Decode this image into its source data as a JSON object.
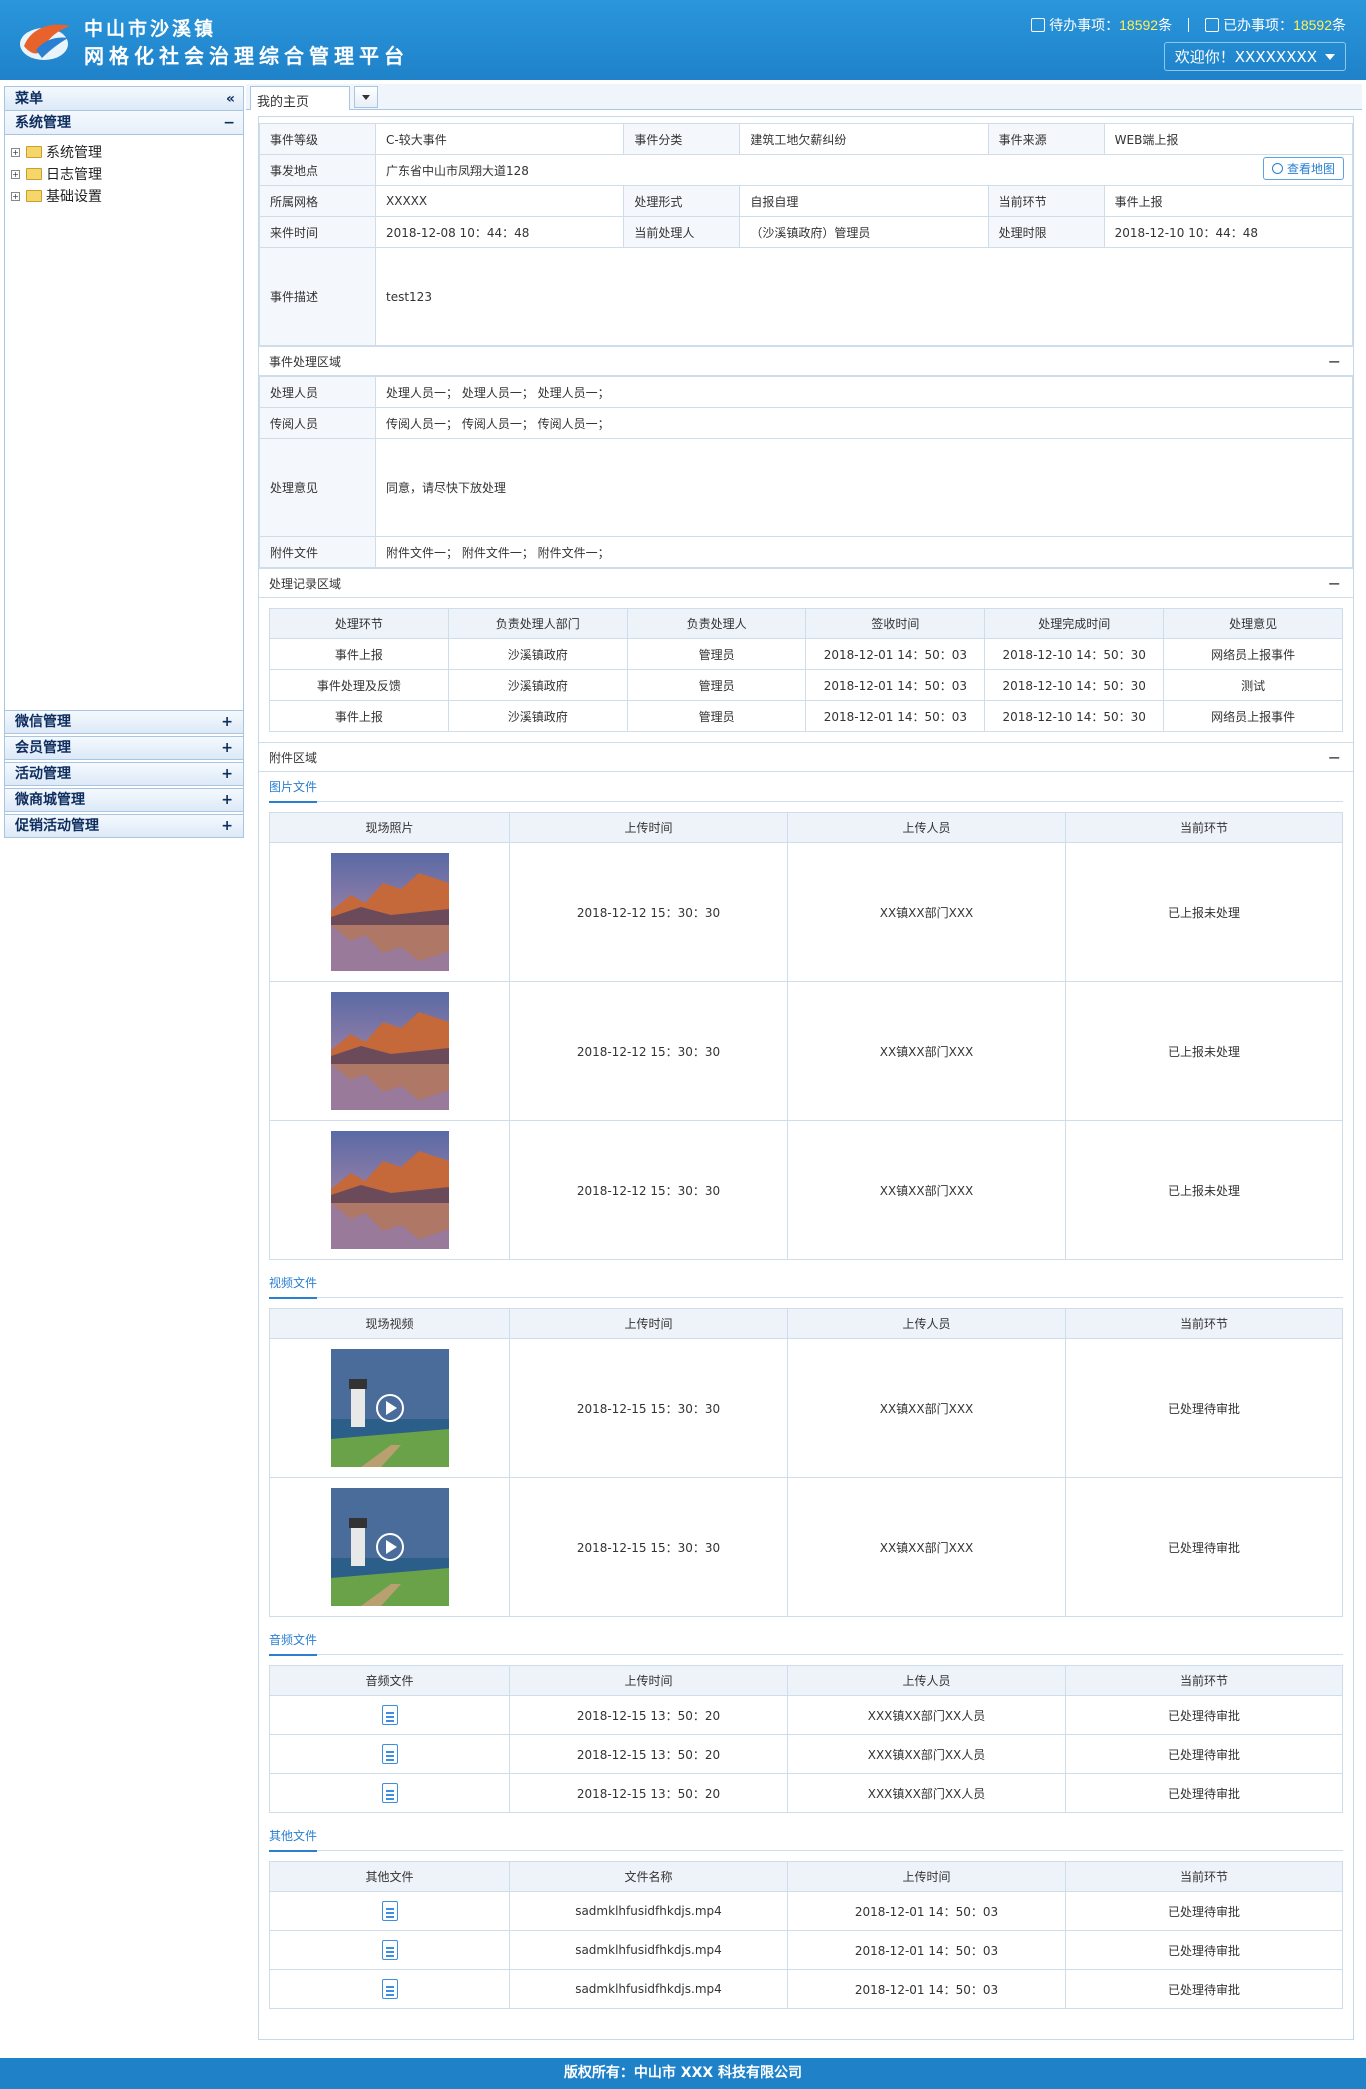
{
  "header": {
    "title_line1": "中山市沙溪镇",
    "title_line2": "网格化社会治理综合管理平台",
    "todo_label": "待办事项：",
    "todo_count": "18592",
    "todo_unit": "条",
    "done_label": "已办事项：",
    "done_count": "18592",
    "done_unit": "条",
    "welcome": "欢迎你！XXXXXXXX"
  },
  "sidebar": {
    "menu_title": "菜单",
    "collapse_glyph": "«",
    "group_title": "系统管理",
    "group_toggle": "−",
    "tree": [
      {
        "label": "系统管理"
      },
      {
        "label": "日志管理"
      },
      {
        "label": "基础设置"
      }
    ],
    "accordions": [
      {
        "label": "微信管理",
        "glyph": "+"
      },
      {
        "label": "会员管理",
        "glyph": "+"
      },
      {
        "label": "活动管理",
        "glyph": "+"
      },
      {
        "label": "微商城管理",
        "glyph": "+"
      },
      {
        "label": "促销活动管理",
        "glyph": "+"
      }
    ]
  },
  "tabs": {
    "home": "我的主页"
  },
  "event": {
    "level_label": "事件等级",
    "level": "C-较大事件",
    "category_label": "事件分类",
    "category": "建筑工地欠薪纠纷",
    "source_label": "事件来源",
    "source": "WEB端上报",
    "location_label": "事发地点",
    "location": "广东省中山市凤翔大道128",
    "map_button": "查看地图",
    "grid_label": "所属网格",
    "grid": "XXXXX",
    "form_label": "处理形式",
    "form": "自报自理",
    "stage_label": "当前环节",
    "stage": "事件上报",
    "time_label": "来件时间",
    "time": "2018-12-08 10：44：48",
    "handler_label": "当前处理人",
    "handler": "（沙溪镇政府）管理员",
    "deadline_label": "处理时限",
    "deadline": "2018-12-10 10：44：48",
    "desc_label": "事件描述",
    "desc": "test123"
  },
  "process": {
    "section_title": "事件处理区域",
    "toggle": "−",
    "staff_label": "处理人员",
    "staff": "处理人员一；  处理人员一；  处理人员一；",
    "cc_label": "传阅人员",
    "cc": "传阅人员一；  传阅人员一；  传阅人员一；",
    "opinion_label": "处理意见",
    "opinion": "同意，请尽快下放处理",
    "attach_label": "附件文件",
    "attach": "附件文件一；  附件文件一；  附件文件一；"
  },
  "records": {
    "section_title": "处理记录区域",
    "toggle": "−",
    "headers": [
      "处理环节",
      "负责处理人部门",
      "负责处理人",
      "签收时间",
      "处理完成时间",
      "处理意见"
    ],
    "rows": [
      [
        "事件上报",
        "沙溪镇政府",
        "管理员",
        "2018-12-01 14：50：03",
        "2018-12-10 14：50：30",
        "网络员上报事件"
      ],
      [
        "事件处理及反馈",
        "沙溪镇政府",
        "管理员",
        "2018-12-01 14：50：03",
        "2018-12-10 14：50：30",
        "测试"
      ],
      [
        "事件上报",
        "沙溪镇政府",
        "管理员",
        "2018-12-01 14：50：03",
        "2018-12-10 14：50：30",
        "网络员上报事件"
      ]
    ]
  },
  "attachments": {
    "section_title": "附件区域",
    "toggle": "−",
    "images": {
      "tab": "图片文件",
      "headers": [
        "现场照片",
        "上传时间",
        "上传人员",
        "当前环节"
      ],
      "rows": [
        [
          "2018-12-12 15：30：30",
          "XX镇XX部门XXX",
          "已上报未处理"
        ],
        [
          "2018-12-12 15：30：30",
          "XX镇XX部门XXX",
          "已上报未处理"
        ],
        [
          "2018-12-12 15：30：30",
          "XX镇XX部门XXX",
          "已上报未处理"
        ]
      ]
    },
    "videos": {
      "tab": "视频文件",
      "headers": [
        "现场视频",
        "上传时间",
        "上传人员",
        "当前环节"
      ],
      "rows": [
        [
          "2018-12-15 15：30：30",
          "XX镇XX部门XXX",
          "已处理待审批"
        ],
        [
          "2018-12-15 15：30：30",
          "XX镇XX部门XXX",
          "已处理待审批"
        ]
      ]
    },
    "audios": {
      "tab": "音频文件",
      "headers": [
        "音频文件",
        "上传时间",
        "上传人员",
        "当前环节"
      ],
      "rows": [
        [
          "2018-12-15 13：50：20",
          "XXX镇XX部门XX人员",
          "已处理待审批"
        ],
        [
          "2018-12-15 13：50：20",
          "XXX镇XX部门XX人员",
          "已处理待审批"
        ],
        [
          "2018-12-15 13：50：20",
          "XXX镇XX部门XX人员",
          "已处理待审批"
        ]
      ]
    },
    "others": {
      "tab": "其他文件",
      "headers": [
        "其他文件",
        "文件名称",
        "上传时间",
        "当前环节"
      ],
      "rows": [
        [
          "sadmklhfusidfhkdjs.mp4",
          "2018-12-01 14：50：03",
          "已处理待审批"
        ],
        [
          "sadmklhfusidfhkdjs.mp4",
          "2018-12-01 14：50：03",
          "已处理待审批"
        ],
        [
          "sadmklhfusidfhkdjs.mp4",
          "2018-12-01 14：50：03",
          "已处理待审批"
        ]
      ]
    }
  },
  "footer": {
    "text": "版权所有：中山市 XXX 科技有限公司"
  }
}
